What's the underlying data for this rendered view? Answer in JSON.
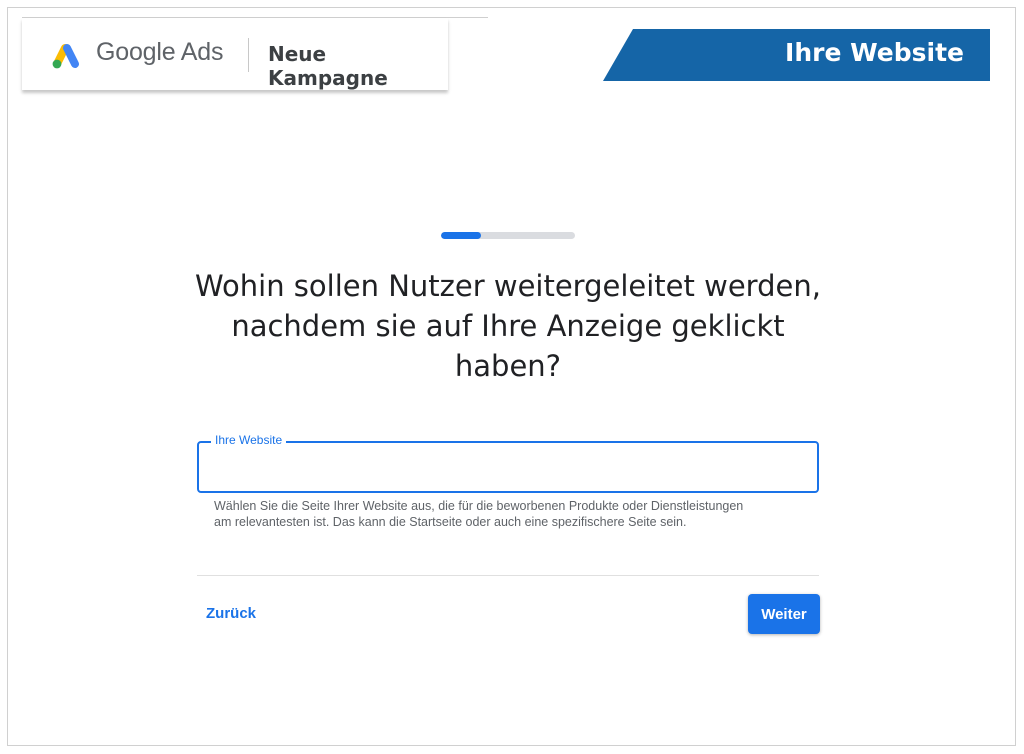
{
  "header": {
    "brand": "Google Ads",
    "campaign_title": "Neue Kampagne"
  },
  "banner": {
    "text": "Ihre Website",
    "color": "#1565a7"
  },
  "progress": {
    "fraction": 0.3
  },
  "question": {
    "line1": "Wohin sollen Nutzer weitergeleitet werden,",
    "line2": "nachdem sie auf Ihre Anzeige geklickt",
    "line3": "haben?"
  },
  "website_field": {
    "label": "Ihre Website",
    "value": "",
    "helper_line1": "Wählen Sie die Seite Ihrer Website aus, die für die beworbenen Produkte oder Dienstleistungen",
    "helper_line2": "am relevantesten ist. Das kann die Startseite oder auch eine spezifischere Seite sein."
  },
  "actions": {
    "back_label": "Zurück",
    "next_label": "Weiter"
  },
  "colors": {
    "accent": "#1a73e8",
    "logo_blue": "#4285f4",
    "logo_yellow": "#fbbc04",
    "logo_green": "#34a853"
  }
}
